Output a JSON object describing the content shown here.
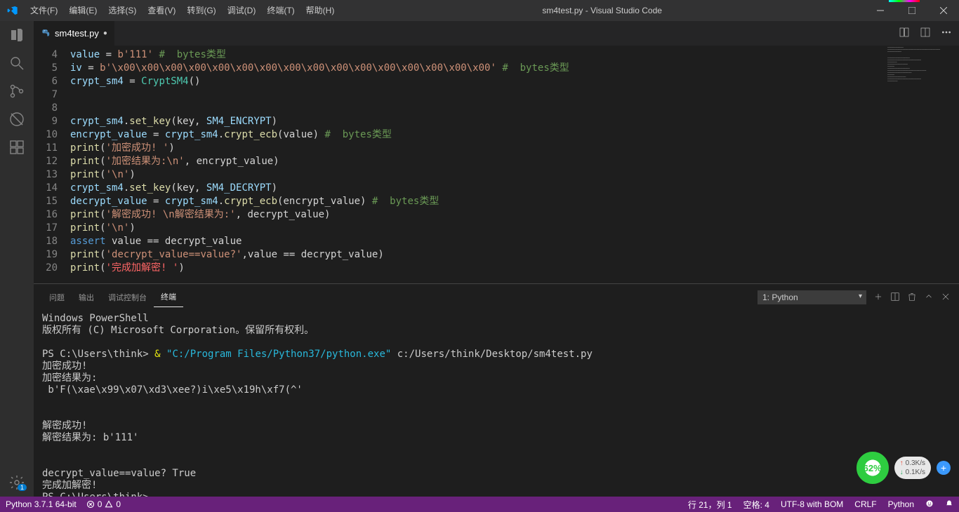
{
  "window": {
    "title": "sm4test.py - Visual Studio Code"
  },
  "menu": [
    "文件(F)",
    "编辑(E)",
    "选择(S)",
    "查看(V)",
    "转到(G)",
    "调试(D)",
    "终端(T)",
    "帮助(H)"
  ],
  "activity": {
    "bottom_badge": "1"
  },
  "tabs": [
    {
      "label": "sm4test.py",
      "modified": true
    }
  ],
  "code_start": 4,
  "code_lines": [
    [
      {
        "c": "var",
        "t": "value"
      },
      {
        "c": "",
        "t": " = "
      },
      {
        "c": "str",
        "t": "b'111'"
      },
      {
        "c": "",
        "t": " "
      },
      {
        "c": "cmt",
        "t": "#  bytes类型"
      }
    ],
    [
      {
        "c": "var",
        "t": "iv"
      },
      {
        "c": "",
        "t": " = "
      },
      {
        "c": "str",
        "t": "b'\\x00\\x00\\x00\\x00\\x00\\x00\\x00\\x00\\x00\\x00\\x00\\x00\\x00\\x00\\x00\\x00'"
      },
      {
        "c": "",
        "t": " "
      },
      {
        "c": "cmt",
        "t": "#  bytes类型"
      }
    ],
    [
      {
        "c": "var",
        "t": "crypt_sm4"
      },
      {
        "c": "",
        "t": " = "
      },
      {
        "c": "cls",
        "t": "CryptSM4"
      },
      {
        "c": "",
        "t": "()"
      }
    ],
    [],
    [],
    [
      {
        "c": "var",
        "t": "crypt_sm4"
      },
      {
        "c": "",
        "t": "."
      },
      {
        "c": "fn",
        "t": "set_key"
      },
      {
        "c": "",
        "t": "(key, "
      },
      {
        "c": "var",
        "t": "SM4_ENCRYPT"
      },
      {
        "c": "",
        "t": ")"
      }
    ],
    [
      {
        "c": "var",
        "t": "encrypt_value"
      },
      {
        "c": "",
        "t": " = "
      },
      {
        "c": "var",
        "t": "crypt_sm4"
      },
      {
        "c": "",
        "t": "."
      },
      {
        "c": "fn",
        "t": "crypt_ecb"
      },
      {
        "c": "",
        "t": "(value) "
      },
      {
        "c": "cmt",
        "t": "#  bytes类型"
      }
    ],
    [
      {
        "c": "fn",
        "t": "print"
      },
      {
        "c": "",
        "t": "("
      },
      {
        "c": "str",
        "t": "'加密成功! '"
      },
      {
        "c": "",
        "t": ")"
      }
    ],
    [
      {
        "c": "fn",
        "t": "print"
      },
      {
        "c": "",
        "t": "("
      },
      {
        "c": "str",
        "t": "'加密结果为:\\n'"
      },
      {
        "c": "",
        "t": ", encrypt_value)"
      }
    ],
    [
      {
        "c": "fn",
        "t": "print"
      },
      {
        "c": "",
        "t": "("
      },
      {
        "c": "str",
        "t": "'\\n'"
      },
      {
        "c": "",
        "t": ")"
      }
    ],
    [
      {
        "c": "var",
        "t": "crypt_sm4"
      },
      {
        "c": "",
        "t": "."
      },
      {
        "c": "fn",
        "t": "set_key"
      },
      {
        "c": "",
        "t": "(key, "
      },
      {
        "c": "var",
        "t": "SM4_DECRYPT"
      },
      {
        "c": "",
        "t": ")"
      }
    ],
    [
      {
        "c": "var",
        "t": "decrypt_value"
      },
      {
        "c": "",
        "t": " = "
      },
      {
        "c": "var",
        "t": "crypt_sm4"
      },
      {
        "c": "",
        "t": "."
      },
      {
        "c": "fn",
        "t": "crypt_ecb"
      },
      {
        "c": "",
        "t": "(encrypt_value) "
      },
      {
        "c": "cmt",
        "t": "#  bytes类型"
      }
    ],
    [
      {
        "c": "fn",
        "t": "print"
      },
      {
        "c": "",
        "t": "("
      },
      {
        "c": "str",
        "t": "'解密成功! \\n解密结果为:'"
      },
      {
        "c": "",
        "t": ", decrypt_value)"
      }
    ],
    [
      {
        "c": "fn",
        "t": "print"
      },
      {
        "c": "",
        "t": "("
      },
      {
        "c": "str",
        "t": "'\\n'"
      },
      {
        "c": "",
        "t": ")"
      }
    ],
    [
      {
        "c": "kw",
        "t": "assert"
      },
      {
        "c": "",
        "t": " value == decrypt_value"
      }
    ],
    [
      {
        "c": "fn",
        "t": "print"
      },
      {
        "c": "",
        "t": "("
      },
      {
        "c": "str",
        "t": "'decrypt_value==value?'"
      },
      {
        "c": "",
        "t": ",value == decrypt_value)"
      }
    ],
    [
      {
        "c": "fn",
        "t": "print"
      },
      {
        "c": "",
        "t": "("
      },
      {
        "c": "red",
        "t": "'完成加解密! '"
      },
      {
        "c": "",
        "t": ")"
      }
    ]
  ],
  "panel": {
    "tabs": [
      "问题",
      "输出",
      "调试控制台",
      "终端"
    ],
    "active_tab": 3,
    "terminal_selector": "1: Python"
  },
  "terminal_lines": [
    [
      {
        "c": "",
        "t": "Windows PowerShell"
      }
    ],
    [
      {
        "c": "",
        "t": "版权所有 (C) Microsoft Corporation。保留所有权利。"
      }
    ],
    [],
    [
      {
        "c": "",
        "t": "PS C:\\Users\\think> "
      },
      {
        "c": "yellow",
        "t": "& "
      },
      {
        "c": "cyan",
        "t": "\"C:/Program Files/Python37/python.exe\""
      },
      {
        "c": "",
        "t": " c:/Users/think/Desktop/sm4test.py"
      }
    ],
    [
      {
        "c": "",
        "t": "加密成功!"
      }
    ],
    [
      {
        "c": "",
        "t": "加密结果为:"
      }
    ],
    [
      {
        "c": "",
        "t": " b'F(\\xae\\x99\\x07\\xd3\\xee?)i\\xe5\\x19h\\xf7(^'"
      }
    ],
    [],
    [],
    [
      {
        "c": "",
        "t": "解密成功!"
      }
    ],
    [
      {
        "c": "",
        "t": "解密结果为: b'111'"
      }
    ],
    [],
    [],
    [
      {
        "c": "",
        "t": "decrypt_value==value? True"
      }
    ],
    [
      {
        "c": "",
        "t": "完成加解密!"
      }
    ],
    [
      {
        "c": "",
        "t": "PS C:\\Users\\think>"
      }
    ]
  ],
  "status": {
    "python": "Python 3.7.1 64-bit",
    "errors": "0",
    "warnings": "0",
    "cursor": "行 21，列 1",
    "indent": "空格: 4",
    "encoding": "UTF-8 with BOM",
    "eol": "CRLF",
    "lang": "Python"
  },
  "float": {
    "cpu": "62%",
    "up": "0.3K/s",
    "dn": "0.1K/s"
  }
}
